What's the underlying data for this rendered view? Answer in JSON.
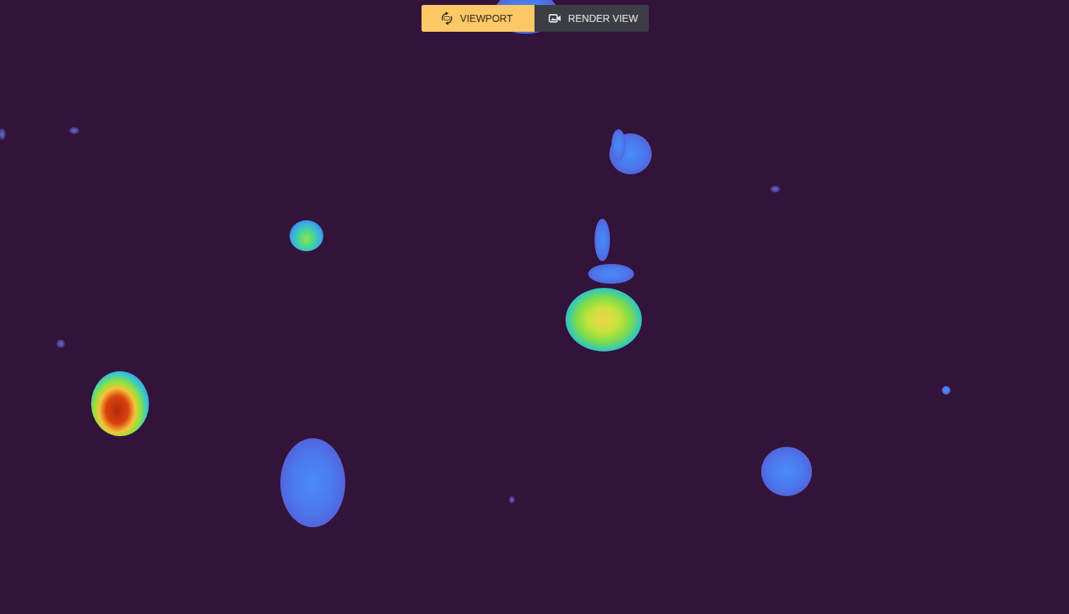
{
  "view_toggle": {
    "buttons": [
      {
        "label": "VIEWPORT",
        "selected": true,
        "kind": "viewport"
      },
      {
        "label": "RENDER VIEW",
        "selected": false,
        "kind": "render"
      }
    ]
  }
}
